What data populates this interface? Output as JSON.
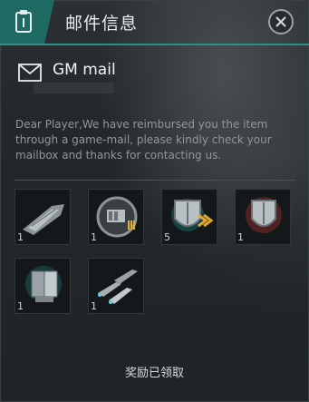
{
  "header": {
    "title": "邮件信息"
  },
  "mail": {
    "subject": "GM mail",
    "body": "Dear Player,We have reimbursed you the item through a game-mail, please kindly check your mailbox and thanks for contacting us."
  },
  "attachments": [
    {
      "icon": "battleship-icon",
      "count": "1"
    },
    {
      "icon": "gunship-badge-icon",
      "count": "1"
    },
    {
      "icon": "shield-chevron-icon",
      "count": "5"
    },
    {
      "icon": "red-shield-icon",
      "count": "1"
    },
    {
      "icon": "armor-module-icon",
      "count": "1"
    },
    {
      "icon": "fighter-squadron-icon",
      "count": "1"
    }
  ],
  "footer": {
    "status": "奖励已领取"
  },
  "colors": {
    "accent": "#1e6a62",
    "accent_line": "#2e8f84"
  }
}
